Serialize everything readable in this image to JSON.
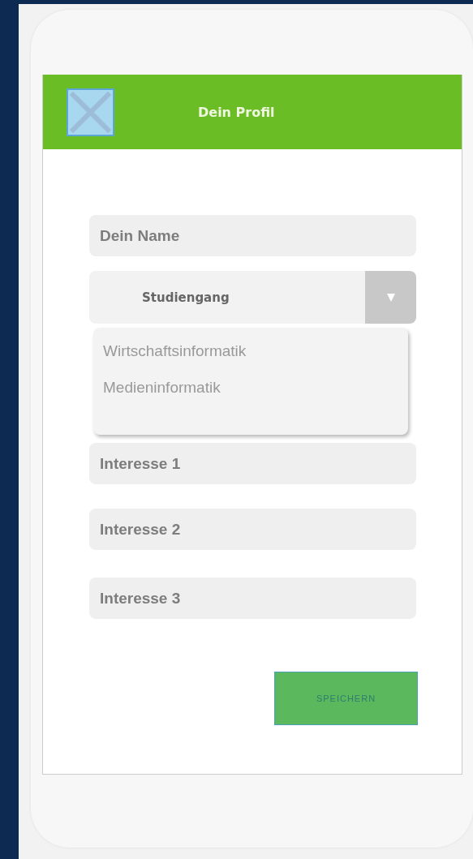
{
  "header": {
    "title": "Dein Profil"
  },
  "name_field": {
    "placeholder": "Dein Name"
  },
  "dropdown": {
    "label": "Studiengang",
    "expanded": true,
    "options": [
      "Wirtschaftsinformatik",
      "Medieninformatik"
    ]
  },
  "interest_fields": [
    {
      "placeholder": "Interesse 1"
    },
    {
      "placeholder": "Interesse 2"
    },
    {
      "placeholder": "Interesse 3"
    }
  ],
  "save_button": {
    "label": "SPEICHERN"
  }
}
